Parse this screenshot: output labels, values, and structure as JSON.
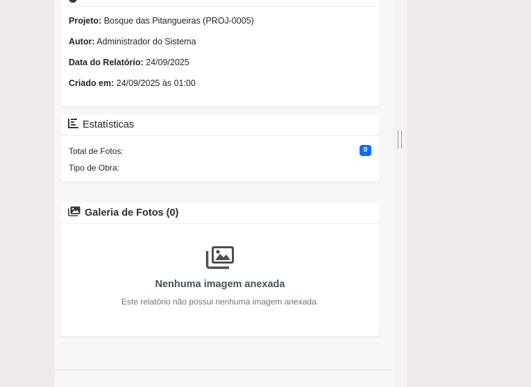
{
  "info_card": {
    "rows": [
      {
        "label": "Projeto:",
        "value": "Bosque das Pitangueiras (PROJ-0005)"
      },
      {
        "label": "Autor:",
        "value": "Administrador do Sistema"
      },
      {
        "label": "Data do Relatório:",
        "value": "24/09/2025"
      },
      {
        "label": "Criado em:",
        "value": "24/09/2025 às 01:00"
      }
    ]
  },
  "stats_card": {
    "title": "Estatísticas",
    "icon": "bar-chart-icon",
    "total_photos_label": "Total de Fotos:",
    "total_photos_value": "0",
    "work_type_label": "Tipo de Obra:",
    "work_type_value": ""
  },
  "gallery_card": {
    "title": "Galeria de Fotos (0)",
    "icon": "images-icon",
    "empty_title": "Nenhuma imagem anexada",
    "empty_subtitle": "Este relatório não possui nenhuma imagem anexada."
  },
  "colors": {
    "badge": "#0d6efd",
    "page_background": "#efe9ec",
    "content_background": "#f6f7f9"
  }
}
